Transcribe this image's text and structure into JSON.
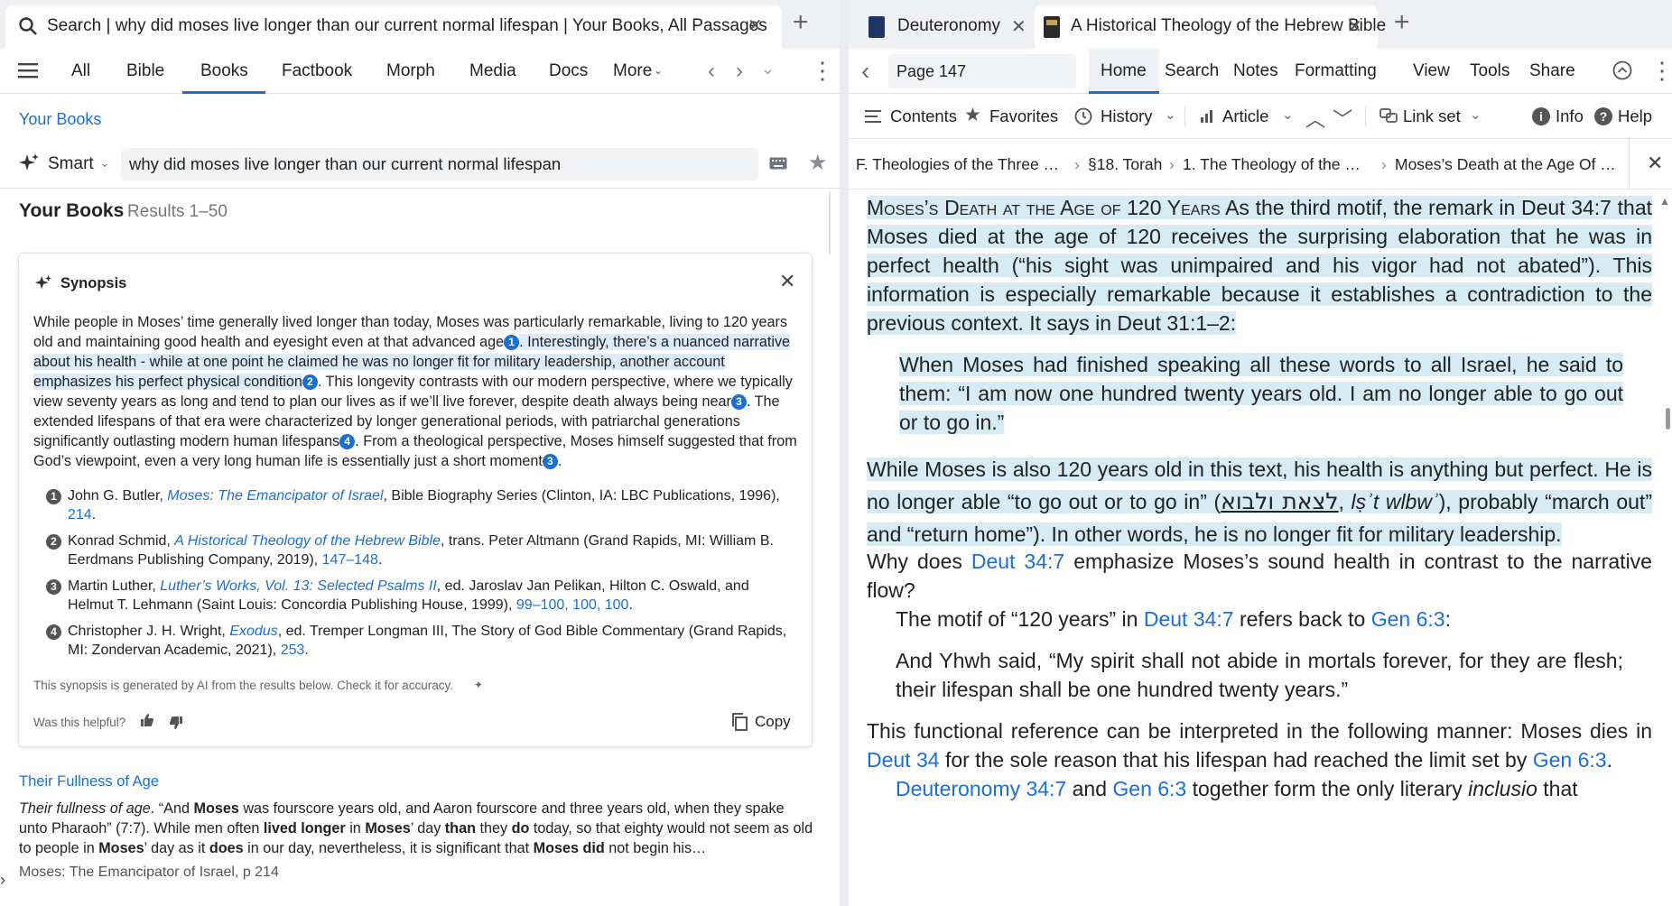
{
  "left": {
    "tab": {
      "title": "Search | why did moses live longer than our current normal lifespan | Your Books, All Passages"
    },
    "nav": {
      "items": [
        "All",
        "Bible",
        "Books",
        "Factbook",
        "Morph",
        "Media",
        "Docs",
        "More"
      ]
    },
    "scope_label": "Your Books",
    "search": {
      "mode": "Smart",
      "query": "why did moses live longer than our current normal lifespan"
    },
    "results_header": {
      "title": "Your Books",
      "range": "Results 1–50"
    },
    "synopsis": {
      "title": "Synopsis",
      "p1": "While people in Moses’ time generally lived longer than today, Moses was particularly remarkable, living to 120 years old and maintaining good health and eyesight even at that advanced age",
      "p2": ". Interestingly, there’s a nuanced narrative about his health - while at one point he claimed he was no longer fit for military leadership, another account emphasizes his perfect physical condition",
      "p3": ". This longevity contrasts with our modern perspective, where we typically view seventy years as long and tend to plan our lives as if we’ll live forever, despite death always being near",
      "p4": ". The extended lifespans of that era were characterized by longer generational periods, with patriarchal generations significantly outlasting modern human lifespans",
      "p5": ". From a theological perspective, Moses himself suggested that from God’s viewpoint, even a very long human life is essentially just a short moment",
      "p6": ".",
      "c1": "1",
      "c2": "2",
      "c3": "3",
      "c4": "4",
      "footnotes": [
        {
          "num": "1",
          "pre": "John G. Butler, ",
          "title": "Moses: The Emancipator of Israel",
          "post": ", Bible Biography Series (Clinton, IA: LBC Publications, 1996),",
          "links": "214",
          "end": "."
        },
        {
          "num": "2",
          "pre": "Konrad Schmid, ",
          "title": "A Historical Theology of the Hebrew Bible",
          "post": ", trans. Peter Altmann (Grand Rapids, MI: William B. Eerdmans Publishing Company, 2019),",
          "links": "147–148",
          "end": "."
        },
        {
          "num": "3",
          "pre": "Martin Luther, ",
          "title": "Luther’s Works, Vol. 13: Selected Psalms II",
          "post": ", ed. Jaroslav Jan Pelikan, Hilton C. Oswald, and Helmut T. Lehmann (Saint Louis: Concordia Publishing House, 1999),",
          "links": "99–100, 100, 100",
          "end": "."
        },
        {
          "num": "4",
          "pre": "Christopher J. H. Wright, ",
          "title": "Exodus",
          "post": ", ed. Tremper Longman III, The Story of God Bible Commentary (Grand Rapids, MI: Zondervan Academic, 2021),",
          "links": "253",
          "end": "."
        }
      ],
      "disclaimer": "This synopsis is generated by AI from the results below. Check it for accuracy.",
      "helpful": "Was this helpful?",
      "copy": "Copy"
    },
    "result1": {
      "title": "Their Fullness of Age",
      "snippet_html": "<i>Their fullness of age</i>. “And <b>Moses</b> was fourscore years old, and Aaron fourscore and three years old, when they spake unto Pharaoh” (7:7). While men often <b>lived longer</b> in <b>Moses</b>’ day <b>than</b> they <b>do</b> today, so that eighty would not seem as old to people in <b>Moses</b>’ day as it <b>does</b> in our day, nevertheless, it is significant that <b>Moses did</b> not begin his…",
      "source": "Moses: The Emancipator of Israel, p 214"
    }
  },
  "right": {
    "tabs": [
      {
        "title": "Deuteronomy"
      },
      {
        "title": "A Historical Theology of the Hebrew Bible"
      }
    ],
    "page": "Page 147",
    "nav": {
      "items": [
        "Home",
        "Search",
        "Notes",
        "Formatting",
        "View",
        "Tools",
        "Share"
      ]
    },
    "toolbar": {
      "contents": "Contents",
      "favorites": "Favorites",
      "history": "History",
      "article": "Article",
      "linkset": "Link set",
      "info": "Info",
      "help": "Help"
    },
    "breadcrumb": [
      "F. Theologies of the Three …",
      "§18. Torah",
      "1. The Theology of the …",
      "Moses’s Death at the Age Of …"
    ],
    "body": {
      "heading": "Moses’s Death at the Age of 120 Years",
      "p1": "As the third motif, the remark in Deut 34:7 that Moses died at the age of 120 receives the surprising elaboration that he was in perfect health (“his sight was unimpaired and his vigor had not abated”). This information is especially remarkable because it establishes a contradiction to the previous context. It says in Deut 31:1–2:",
      "quote1": "When Moses had finished speaking all these words to all Israel, he said to them: “I am now one hundred twenty years old. I am no longer able to go out or to go in.”",
      "p2a": "While Moses is also 120 years old in this text, his health is anything but perfect. He is no longer able “to go out or to go in” (",
      "hebrew": "לצאת ולבוא",
      "translit": "lṣʾt wlbwʾ",
      "p2b": "), probably “march out” and “return home”). In other words, he is no longer fit for military leadership.",
      "p2c": "Why does ",
      "ref_deut347": "Deut 34:7",
      "p2d": " emphasize Moses’s sound health in contrast to the narrative flow?",
      "p3a": "The motif of “120 years” in ",
      "p3b": " refers back to ",
      "ref_gen63": "Gen 6:3",
      "p3c": ":",
      "quote2": "And Yhwh said, “My spirit shall not abide in mortals forever, for they are flesh; their lifespan shall be one hundred twenty years.”",
      "p4a": "This functional reference can be interpreted in the following manner: Moses dies in ",
      "ref_deut34": "Deut 34",
      "p4b": " for the sole reason that his lifespan had reached the limit set by ",
      "p4c": ".",
      "ref_deuteronomy347": "Deuteronomy 34:7",
      "p5a": " and ",
      "p5b": " together form the only literary ",
      "inclusio": "inclusio",
      "p5c": " that"
    }
  }
}
